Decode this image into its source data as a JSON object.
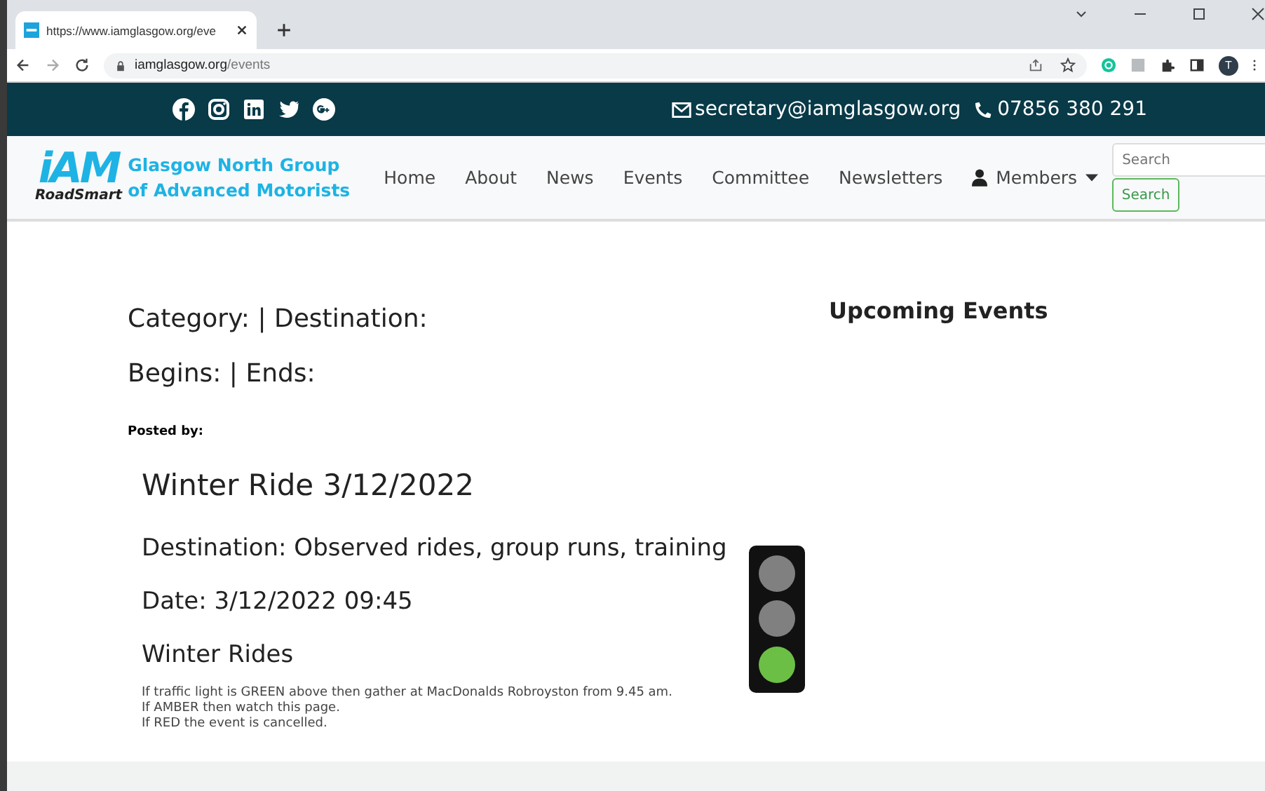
{
  "browser": {
    "tab_title": "https://www.iamglasgow.org/eve",
    "url_host": "iamglasgow.org",
    "url_path": "/events",
    "profile_initial": "T"
  },
  "topbar": {
    "email": "secretary@iamglasgow.org",
    "phone": "07856 380 291"
  },
  "logo": {
    "mark": "iAM",
    "sub": "RoadSmart",
    "group_line1": "Glasgow North Group",
    "group_line2": "of Advanced Motorists"
  },
  "nav": [
    {
      "label": "Home"
    },
    {
      "label": "About"
    },
    {
      "label": "News"
    },
    {
      "label": "Events"
    },
    {
      "label": "Committee"
    },
    {
      "label": "Newsletters"
    },
    {
      "label": "Members",
      "kind": "dropdown"
    }
  ],
  "search": {
    "placeholder": "Search",
    "button": "Search"
  },
  "meta": {
    "category_line": "Category: | Destination:",
    "begins_line": "Begins: | Ends:",
    "posted_by": "Posted by:"
  },
  "sidebar": {
    "title": "Upcoming Events"
  },
  "event": {
    "title": "Winter Ride 3/12/2022",
    "destination": "Destination: Observed rides, group runs, training",
    "date": "Date: 3/12/2022 09:45",
    "subtitle": "Winter Rides",
    "notes": [
      "If traffic light is GREEN above then gather at MacDonalds Robroyston from 9.45 am.",
      "If AMBER then watch this page.",
      "If RED the event is cancelled."
    ]
  },
  "traffic_light": [
    {
      "on": false
    },
    {
      "on": false
    },
    {
      "on": true
    }
  ]
}
